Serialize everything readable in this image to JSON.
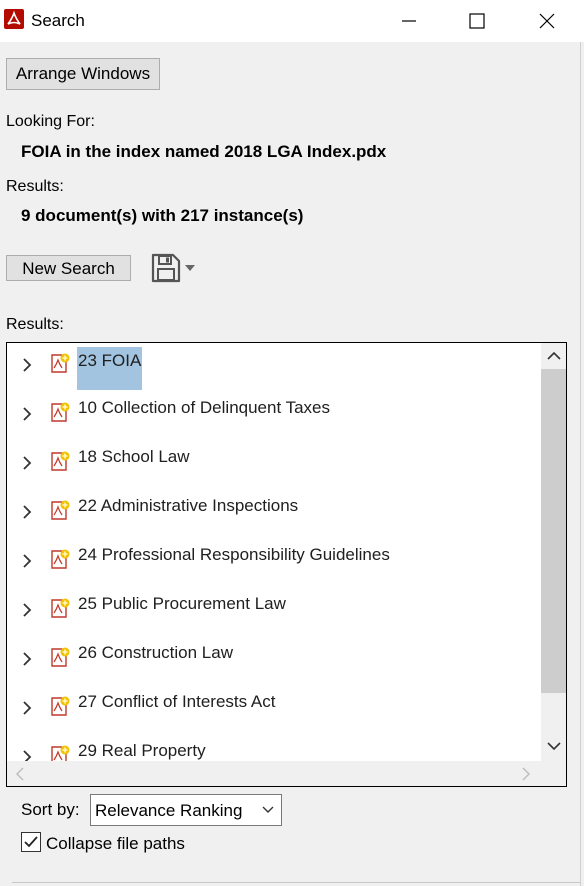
{
  "window": {
    "title": "Search",
    "icon": "acrobat-icon",
    "controls": [
      "minimize-icon",
      "maximize-icon",
      "close-icon"
    ]
  },
  "toolbar": {
    "arrange_label": "Arrange Windows"
  },
  "looking_for": {
    "label": "Looking For:",
    "value": "FOIA in the index named 2018 LGA Index.pdx"
  },
  "summary": {
    "label": "Results:",
    "value": "9 document(s) with 217 instance(s)"
  },
  "actions": {
    "new_search_label": "New Search",
    "save_icon": "save-icon",
    "dropdown_icon": "caret-down-icon"
  },
  "results": {
    "label": "Results:",
    "items": [
      {
        "label": "23 FOIA",
        "selected": true
      },
      {
        "label": "10 Collection of Delinquent Taxes",
        "selected": false
      },
      {
        "label": "18 School Law",
        "selected": false
      },
      {
        "label": "22 Administrative Inspections",
        "selected": false
      },
      {
        "label": "24 Professional Responsibility Guidelines",
        "selected": false
      },
      {
        "label": "25 Public Procurement Law",
        "selected": false
      },
      {
        "label": "26 Construction Law",
        "selected": false
      },
      {
        "label": "27 Conflict of Interests Act",
        "selected": false
      },
      {
        "label": "29 Real Property",
        "selected": false
      }
    ]
  },
  "sort": {
    "label": "Sort by:",
    "value": "Relevance Ranking"
  },
  "options": {
    "collapse_label": "Collapse file paths",
    "collapse_checked": true
  },
  "colors": {
    "selection": "#a2c4e0",
    "acrobat_red": "#b30b00",
    "pdf_star": "#f2c200"
  }
}
